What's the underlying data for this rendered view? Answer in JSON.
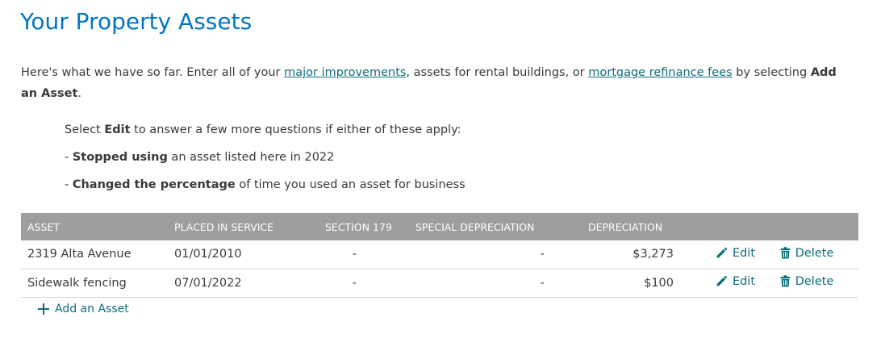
{
  "page_title": "Your Property Assets",
  "intro": {
    "part1": "Here's what we have so far. Enter all of your ",
    "link1": "major improvements",
    "part2": ", assets for rental buildings, or ",
    "link2": "mortgage refinance fees",
    "part3": " by selecting ",
    "bold_action": "Add an Asset",
    "part4": "."
  },
  "instructions": {
    "line1_pre": "Select ",
    "line1_bold": "Edit",
    "line1_post": " to answer a few more questions if either of these apply:",
    "line2_pre": "- ",
    "line2_bold": "Stopped using",
    "line2_post": " an asset listed here in 2022",
    "line3_pre": "- ",
    "line3_bold": "Changed the percentage",
    "line3_post": " of time you used an asset for business"
  },
  "table": {
    "headers": {
      "asset": "ASSET",
      "placed": "PLACED IN SERVICE",
      "section179": "SECTION 179",
      "special": "SPECIAL DEPRECIATION",
      "depreciation": "DEPRECIATION"
    },
    "rows": [
      {
        "asset": "2319 Alta Avenue",
        "placed": "01/01/2010",
        "section179": "-",
        "special": "-",
        "depreciation": "$3,273",
        "edit": "Edit",
        "delete": "Delete"
      },
      {
        "asset": "Sidewalk fencing",
        "placed": "07/01/2022",
        "section179": "-",
        "special": "-",
        "depreciation": "$100",
        "edit": "Edit",
        "delete": "Delete"
      }
    ]
  },
  "add_asset_label": "Add an Asset",
  "colors": {
    "title": "#0077c5",
    "link": "#0d6d7c",
    "header_bg": "#9e9e9e",
    "text": "#393a3d"
  },
  "icons": {
    "edit": "pencil-icon",
    "delete": "trash-icon",
    "add": "plus-icon"
  }
}
